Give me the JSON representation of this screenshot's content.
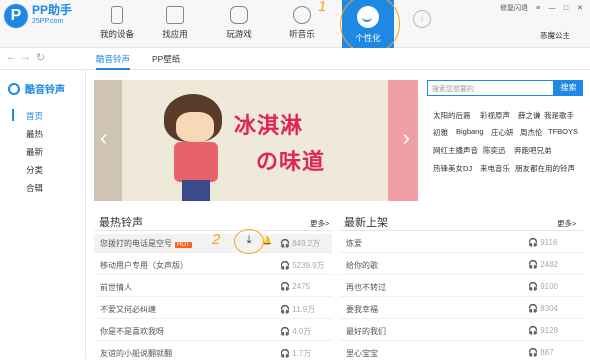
{
  "app": {
    "name": "PP助手",
    "sub": "25PP.com"
  },
  "nav": [
    {
      "label": "我的设备"
    },
    {
      "label": "找应用"
    },
    {
      "label": "玩游戏"
    },
    {
      "label": "听音乐"
    },
    {
      "label": "个性化"
    }
  ],
  "topright": {
    "label": "修复闪退",
    "min": "—",
    "max": "□",
    "close": "✕"
  },
  "user": "恶魔公主",
  "annotations": {
    "one": "1",
    "two": "2"
  },
  "tabs": [
    "酷音铃声",
    "PP壁纸"
  ],
  "sidebar": {
    "title": "酷音铃声",
    "items": [
      "首页",
      "最热",
      "最新",
      "分类",
      "合辑"
    ]
  },
  "banner": {
    "line1": "冰淇淋",
    "line2": "の味道"
  },
  "search": {
    "placeholder": "搜索您想要的",
    "button": "搜索"
  },
  "tags": [
    [
      "太阳的后裔",
      "彩视原声",
      "薛之谦",
      "我是歌手"
    ],
    [
      "初雅",
      "Bigbang",
      "庄心妍",
      "周杰伦",
      "TFBOYS"
    ],
    [
      "网红主播声音",
      "陈奕迅",
      "奔跑吧兄弟"
    ],
    [
      "热锋美女DJ",
      "来电音乐",
      "朋友都在用的铃声"
    ]
  ],
  "hot": {
    "title": "最热铃声",
    "more": "更多>",
    "rows": [
      {
        "name": "您拨打的电话是空号",
        "count": "849.2万",
        "hot": "HOT"
      },
      {
        "name": "移动用户专用（女声版）",
        "count": "5239.9万"
      },
      {
        "name": "前世情人",
        "count": "2475"
      },
      {
        "name": "不爱又何必纠缠",
        "count": "11.9万"
      },
      {
        "name": "你是不是喜欢我呀",
        "count": "4.0万"
      },
      {
        "name": "友谊的小船说翻就翻",
        "count": "1.7万"
      }
    ]
  },
  "new": {
    "title": "最新上架",
    "more": "更多>",
    "rows": [
      {
        "name": "炼爱",
        "count": "9116"
      },
      {
        "name": "给你的歌",
        "count": "2482"
      },
      {
        "name": "再也不转过",
        "count": "9100"
      },
      {
        "name": "要我幸福",
        "count": "8304"
      },
      {
        "name": "最好的我们",
        "count": "9128"
      },
      {
        "name": "里心宝宝",
        "count": "887"
      }
    ]
  },
  "icons": {
    "headphones": "headphones-icon",
    "download": "download-icon",
    "bell": "bell-icon"
  },
  "colors": {
    "accent": "#1e88e5",
    "highlight": "#f5a623",
    "hot": "#f7631b"
  }
}
